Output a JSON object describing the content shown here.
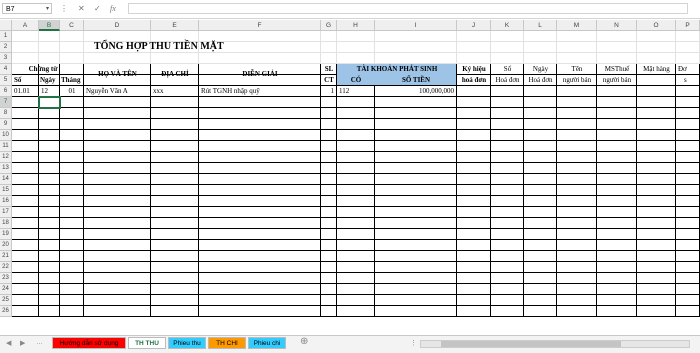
{
  "formula_bar": {
    "name_box": "B7",
    "formula": ""
  },
  "columns": [
    "A",
    "B",
    "C",
    "D",
    "E",
    "F",
    "G",
    "H",
    "I",
    "J",
    "K",
    "L",
    "M",
    "N",
    "O",
    "P"
  ],
  "row_numbers": [
    "1",
    "2",
    "3",
    "4",
    "5",
    "6",
    "7",
    "8",
    "9",
    "10",
    "11",
    "12",
    "13",
    "14",
    "15",
    "16",
    "17",
    "18",
    "19",
    "20",
    "21",
    "22",
    "23",
    "24",
    "25",
    "26"
  ],
  "sheet": {
    "title": "TỔNG HỢP THU TIỀN MẶT",
    "headers": {
      "chung_tu": "Chứng từ",
      "so": "Số",
      "ngay": "Ngày",
      "thang": "Tháng",
      "ho_va_ten": "HỌ VÀ TÊN",
      "dia_chi": "ĐỊA CHỈ",
      "dien_giai": "DIỄN GIẢI",
      "sl": "SL",
      "ct": "CT",
      "tai_khoan_phat_sinh": "TÀI KHOẢN PHÁT SINH",
      "co": "CÓ",
      "so_tien": "SỐ TIỀN",
      "ky_hieu_1": "Ký hiệu",
      "ky_hieu_2": "hoá đơn",
      "so_hd_1": "Số",
      "so_hd_2": "Hoá đơn",
      "ngay_hd_1": "Ngày",
      "ngay_hd_2": "Hoá đơn",
      "ten_nb_1": "Tên",
      "ten_nb_2": "người bán",
      "mst_1": "MSThuế",
      "mst_2": "người bán",
      "mat_hang": "Mặt hàng",
      "don_1": "Đơ",
      "don_2": "s"
    },
    "row6": {
      "so": "01.01",
      "ngay": "12",
      "thang": "01",
      "ho_va_ten": "Nguyễn Văn A",
      "dia_chi": "xxx",
      "dien_giai": "Rút TGNH nhập quỹ",
      "sl": "1",
      "co": "112",
      "so_tien": "100,000,000"
    }
  },
  "tabs": [
    {
      "label": "Hướng dẫn sử dụng",
      "color": "#ff0000"
    },
    {
      "label": "TH THU",
      "color": "#ffffff"
    },
    {
      "label": "Phieu thu",
      "color": "#33ccff"
    },
    {
      "label": "TH CHI",
      "color": "#ff9900"
    },
    {
      "label": "Phieu chi",
      "color": "#33ccff"
    }
  ],
  "active_tab": "TH THU",
  "colors": {
    "header_highlight": "#9dc3e6",
    "excel_green": "#217346"
  }
}
